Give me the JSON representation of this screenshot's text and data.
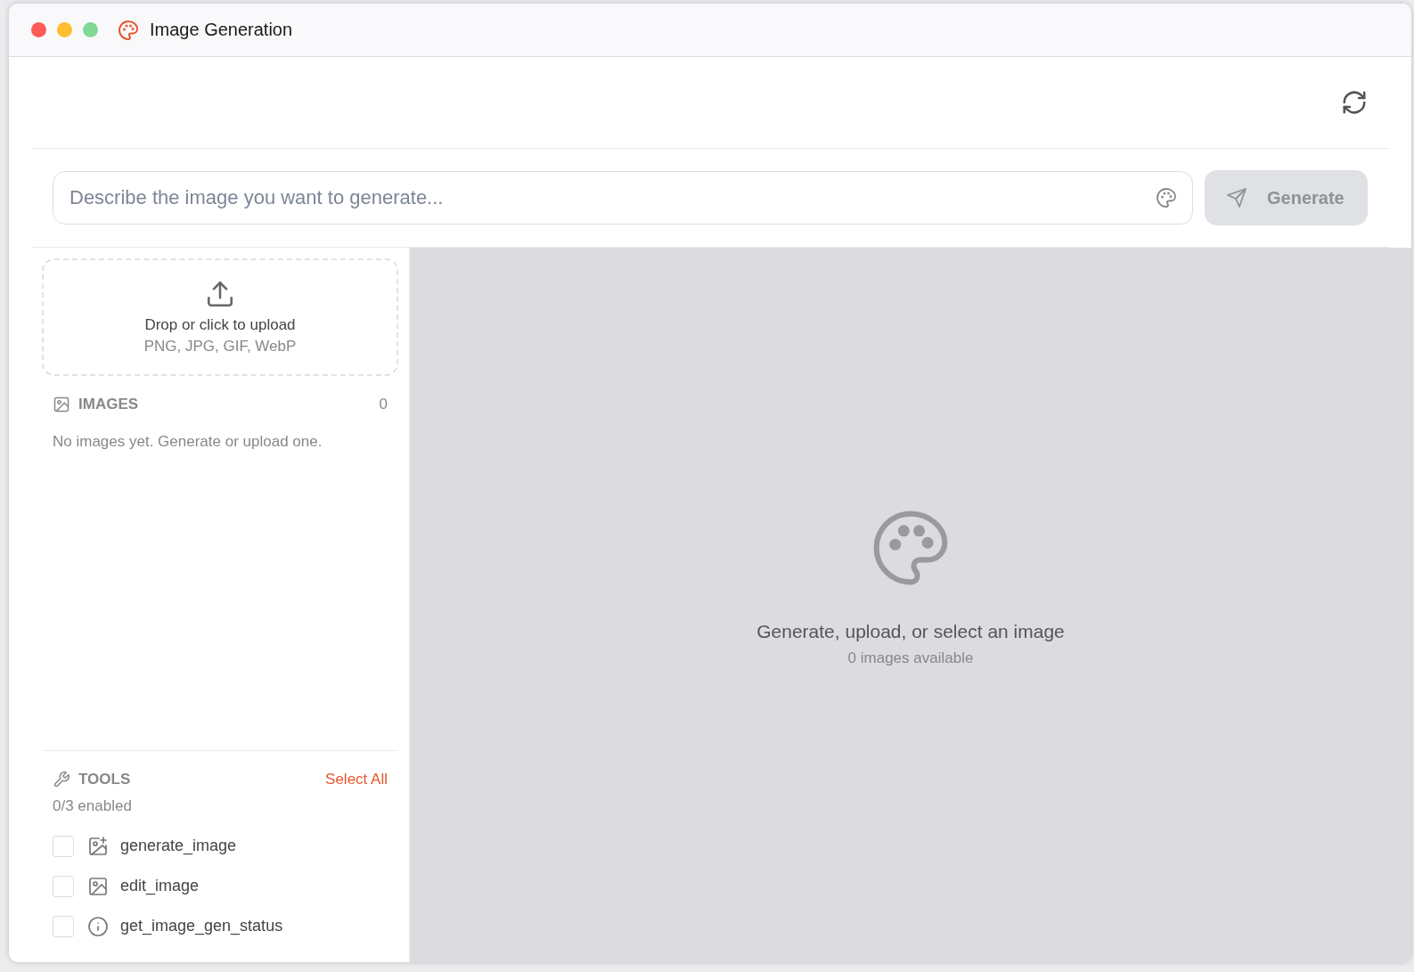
{
  "window": {
    "title": "Image Generation"
  },
  "prompt": {
    "placeholder": "Describe the image you want to generate...",
    "button": "Generate",
    "disabled": true
  },
  "upload": {
    "title": "Drop or click to upload",
    "formats": "PNG, JPG, GIF, WebP"
  },
  "images": {
    "heading": "IMAGES",
    "count": "0",
    "empty": "No images yet. Generate or upload one."
  },
  "tools": {
    "heading": "TOOLS",
    "select_all": "Select All",
    "summary": "0/3 enabled",
    "items": [
      {
        "kind": "generate",
        "name": "generate_image",
        "checked": false
      },
      {
        "kind": "edit",
        "name": "edit_image",
        "checked": false
      },
      {
        "kind": "status",
        "name": "get_image_gen_status",
        "checked": false
      }
    ]
  },
  "preview": {
    "title": "Generate, upload, or select an image",
    "subtitle": "0 images available"
  }
}
